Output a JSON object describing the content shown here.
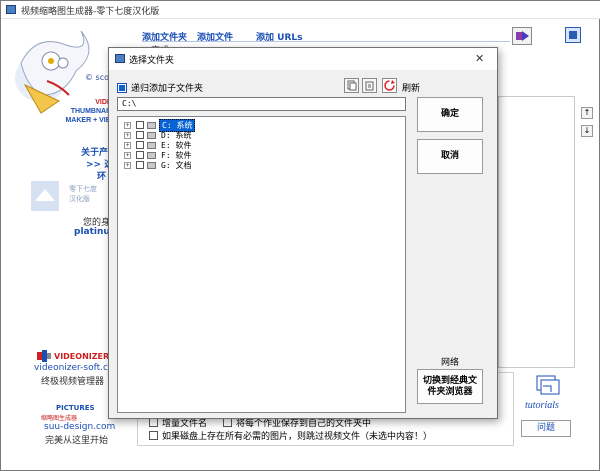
{
  "window": {
    "title": "视频缩略图生成器-零下七度汉化版"
  },
  "toolbar": {
    "add_folder": "添加文件夹",
    "add_file": "添加文件",
    "add_urls": "添加 URLs",
    "done_label": "完成"
  },
  "left": {
    "scorp_text": "© scorp",
    "logo_lines": [
      "VIDEO",
      "THUMBNAILS",
      "MAKER + VIEW"
    ],
    "about_line1": "关于产品",
    "about_line2": ">> 选",
    "about_line3": "环",
    "watermark_line1": "零下七度",
    "watermark_line2": "汉化版",
    "identity_label": "您的身份",
    "identity_value": "platinum [",
    "videonizer_title": "VIDEONIZER",
    "videonizer_site": "videonizer-soft.com",
    "videonizer_desc": "终极视频管理器",
    "pictures_title": "PICTURES",
    "pictures_sub": "缩略图生成器",
    "suu_site": "suu-design.com",
    "suu_desc": "完美从这里开始"
  },
  "bottom": {
    "opt_add_name": "增量文件名",
    "opt_save_each": "将每个作业保存到自己的文件夹中",
    "opt_skip": "如果磁盘上存在所有必需的图片，则跳过视频文件（未选中内容！）",
    "tutorials": "tutorials",
    "question_btn": "问题"
  },
  "dialog": {
    "title": "选择文件夹",
    "recursive_label": "递归添加子文件夹",
    "refresh_label": "刷新",
    "path_value": "C:\\",
    "ok_label": "确定",
    "cancel_label": "取消",
    "network_label": "网络",
    "switch_label": "切换到经典文件夹浏览器",
    "close_glyph": "✕",
    "plus_glyph": "+",
    "drives": [
      {
        "letter": "C:",
        "name": "系统"
      },
      {
        "letter": "D:",
        "name": "系统"
      },
      {
        "letter": "E:",
        "name": "软件"
      },
      {
        "letter": "F:",
        "name": "软件"
      },
      {
        "letter": "G:",
        "name": "文档"
      }
    ]
  },
  "colors": {
    "accent": "#1b4fb4",
    "selection": "#0a64d6",
    "logo_red": "#cc1f1f"
  }
}
